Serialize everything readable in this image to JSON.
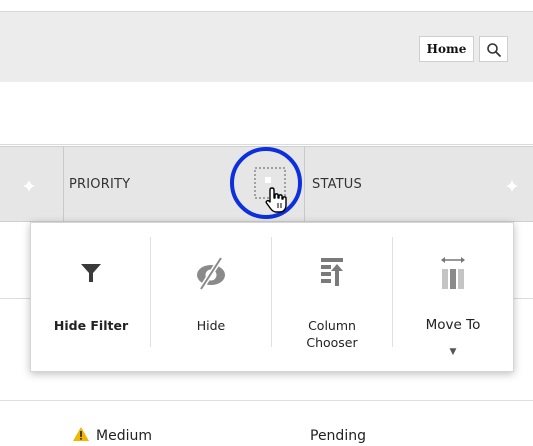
{
  "toolbar": {
    "home_label": "Home",
    "search_icon": "search-icon"
  },
  "grid": {
    "columns": [
      {
        "label": "PRIORITY"
      },
      {
        "label": "STATUS"
      }
    ],
    "rows": [
      {
        "priority": "Medium",
        "status": "Pending"
      }
    ]
  },
  "column_menu": {
    "items": [
      {
        "label": "Hide Filter",
        "icon": "funnel-icon"
      },
      {
        "label": "Hide",
        "icon": "eye-slash-icon"
      },
      {
        "label": "Column\nChooser",
        "icon": "column-chooser-icon"
      },
      {
        "label": "Move To",
        "icon": "move-column-icon"
      }
    ]
  },
  "colors": {
    "cursor_ring": "#0d2fdc",
    "warning": "#f2b600"
  }
}
